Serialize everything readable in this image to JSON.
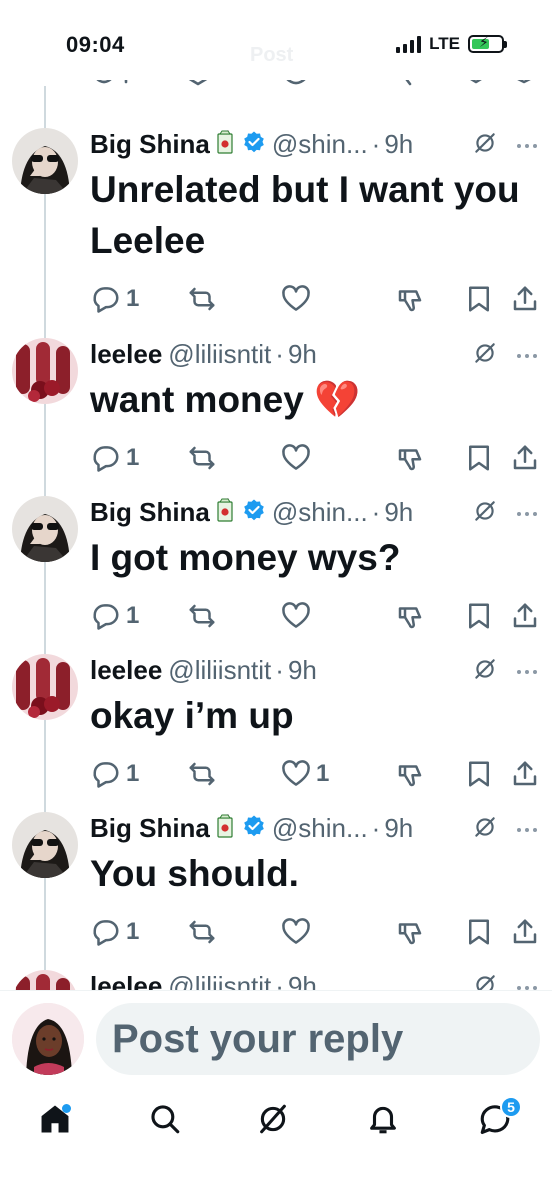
{
  "status_bar": {
    "time": "09:04",
    "network": "LTE"
  },
  "header": {
    "title": "Post"
  },
  "tweets": [
    {
      "name": "Big Shina",
      "handle": "@shin...",
      "time": "9h",
      "verified": true,
      "has_juice_emoji": true,
      "text": "Unrelated but I want you Leelee",
      "reply_count": "1",
      "like_count": "",
      "avatar": "big-shina"
    },
    {
      "name": "leelee",
      "handle": "@liliisntit",
      "time": "9h",
      "verified": false,
      "has_juice_emoji": false,
      "text": "want money 💔",
      "reply_count": "1",
      "like_count": "",
      "avatar": "leelee"
    },
    {
      "name": "Big Shina",
      "handle": "@shin...",
      "time": "9h",
      "verified": true,
      "has_juice_emoji": true,
      "text": "I got money wys?",
      "reply_count": "1",
      "like_count": "",
      "avatar": "big-shina"
    },
    {
      "name": "leelee",
      "handle": "@liliisntit",
      "time": "9h",
      "verified": false,
      "has_juice_emoji": false,
      "text": "okay i’m up",
      "reply_count": "1",
      "like_count": "1",
      "avatar": "leelee"
    },
    {
      "name": "Big Shina",
      "handle": "@shin...",
      "time": "9h",
      "verified": true,
      "has_juice_emoji": true,
      "text": "You should.",
      "reply_count": "1",
      "like_count": "",
      "avatar": "big-shina"
    },
    {
      "name": "leelee",
      "handle": "@liliisntit",
      "time": "9h",
      "verified": false,
      "has_juice_emoji": false,
      "text": "",
      "reply_count": "",
      "like_count": "",
      "avatar": "leelee"
    }
  ],
  "reply": {
    "placeholder": "Post your reply"
  },
  "bottom_nav": {
    "items": [
      "home-icon",
      "search-icon",
      "grok-icon",
      "notifications-icon",
      "messages-icon"
    ],
    "messages_badge": "5"
  },
  "colors": {
    "accent": "#1d9bf0",
    "text": "#0f1419",
    "muted": "#536471",
    "thread_line": "#cfd9de"
  }
}
